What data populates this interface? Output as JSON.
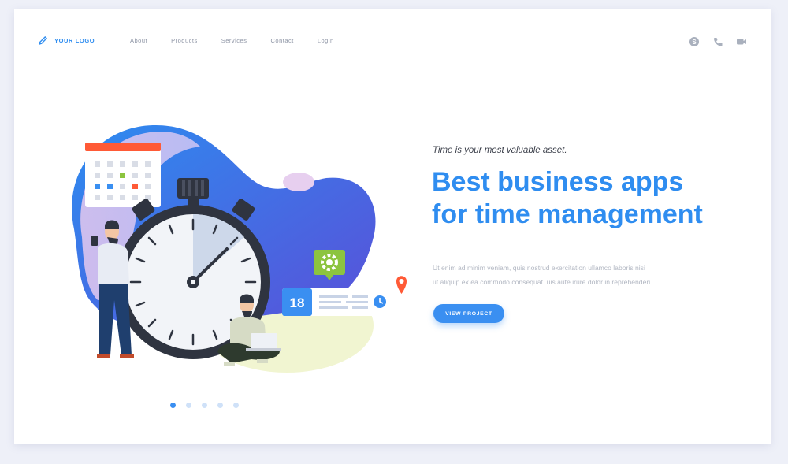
{
  "header": {
    "logo_text": "YOUR LOGO",
    "nav": [
      "About",
      "Products",
      "Services",
      "Contact",
      "Login"
    ],
    "icons": [
      "skype-icon",
      "phone-icon",
      "video-camera-icon"
    ]
  },
  "hero": {
    "tagline": "Time is your most valuable asset.",
    "headline_line1": "Best business apps",
    "headline_line2": "for time management",
    "body_line1": "Ut enim ad minim veniam, quis nostrud exercitation ullamco laboris nisi",
    "body_line2": "ut aliquip ex ea commodo consequat. uis aute irure dolor in reprehenderi",
    "cta_label": "VIEW PROJECT"
  },
  "illustration": {
    "date_number": "18"
  },
  "carousel": {
    "count": 5,
    "active_index": 0
  },
  "colors": {
    "accent": "#2f8df0",
    "button": "#3a8ff1",
    "blob": "#3b6fe0",
    "calendar_header": "#ff5a36",
    "gear_badge": "#8cc43f",
    "pin": "#ff5a36"
  }
}
